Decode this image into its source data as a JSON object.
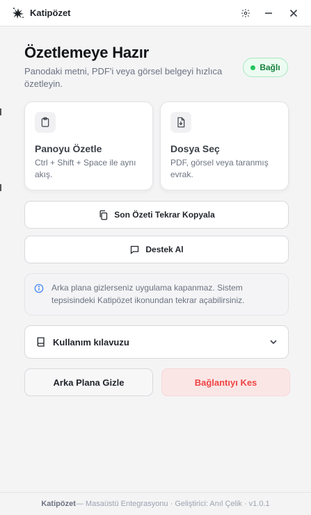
{
  "window": {
    "title": "Katipözet",
    "logo_icon": "ink-splash-icon"
  },
  "header": {
    "heading": "Özetlemeye Hazır",
    "subtitle": "Panodaki metni, PDF'i veya görsel belgeyi hızlıca özetleyin.",
    "status": {
      "label": "Bağlı",
      "color": "#22c55e"
    }
  },
  "cards": [
    {
      "title": "Panoyu Özetle",
      "description": "Ctrl + Shift + Space ile aynı akış.",
      "icon": "clipboard-icon"
    },
    {
      "title": "Dosya Seç",
      "description": "PDF, görsel veya taranmış evrak.",
      "icon": "file-download-icon"
    }
  ],
  "buttons": {
    "copy_last": {
      "label": "Son Özeti Tekrar Kopyala",
      "icon": "copy-icon"
    },
    "support": {
      "label": "Destek Al",
      "icon": "chat-bubble-icon"
    }
  },
  "info": {
    "text": "Arka plana gizlerseniz uygulama kapanmaz. Sistem tepsisindeki Katipözet ikonundan tekrar açabilirsiniz.",
    "icon": "info-icon"
  },
  "guide": {
    "label": "Kullanım kılavuzu",
    "icon": "book-icon",
    "expanded": false
  },
  "actions": {
    "hide": "Arka Plana Gizle",
    "disconnect": "Bağlantıyı Kes",
    "disconnect_color": "#ef4444"
  },
  "footer": {
    "app_name": "Katipözet",
    "rest": " — Masaüstü Entegrasyonu · Geliştirici: Anıl Çelik · v1.0.1"
  }
}
